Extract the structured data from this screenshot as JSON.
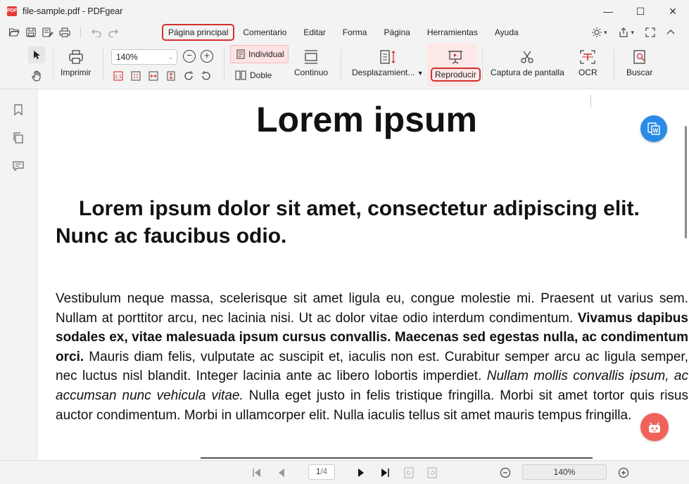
{
  "window": {
    "title": "file-sample.pdf - PDFgear",
    "logo_text": "PDF",
    "minimize": "—",
    "maximize": "☐",
    "close": "✕"
  },
  "menu": {
    "items": [
      {
        "label": "Página principal",
        "active": true
      },
      {
        "label": "Comentario"
      },
      {
        "label": "Editar"
      },
      {
        "label": "Forma"
      },
      {
        "label": "Página"
      },
      {
        "label": "Herramientas"
      },
      {
        "label": "Ayuda"
      }
    ]
  },
  "ribbon": {
    "print_label": "Imprimir",
    "zoom_value": "140%",
    "zoom_out": "−",
    "zoom_in": "+",
    "individual_label": "Individual",
    "double_label": "Doble",
    "continuous_label": "Continuo",
    "scroll_label": "Desplazamient...",
    "play_label": "Reproducir",
    "screenshot_label": "Captura de pantalla",
    "ocr_label": "OCR",
    "search_label": "Buscar"
  },
  "document": {
    "title": "Lorem ipsum",
    "heading": "Lorem ipsum dolor sit amet, consectetur adipiscing elit. Nunc ac faucibus odio.",
    "p1": "Vestibulum neque massa, scelerisque sit amet ligula eu, congue molestie mi. Praesent ut varius sem. Nullam at porttitor arcu, nec lacinia nisi. Ut ac dolor vitae odio interdum condimentum. ",
    "p_bold": "Vivamus dapibus sodales ex, vitae malesuada ipsum cursus convallis. Maecenas sed egestas nulla, ac condimentum orci.",
    "p2": " Mauris diam felis, vulputate ac suscipit et, iaculis non est. Curabitur semper arcu ac ligula semper, nec luctus nisl blandit. Integer lacinia ante ac libero lobortis imperdiet. ",
    "p_italic": "Nullam mollis convallis ipsum, ac accumsan nunc vehicula vitae.",
    "p3": " Nulla eget justo in felis tristique fringilla. Morbi sit amet tortor quis risus auctor condimentum. Morbi in ullamcorper elit. Nulla iaculis tellus sit amet mauris tempus fringilla."
  },
  "statusbar": {
    "current_page": "1",
    "total_pages": "/4",
    "zoom": "140%"
  },
  "colors": {
    "accent": "#d32f2f",
    "highlight": "#fde3e3",
    "fab_blue": "#2a8be6",
    "fab_red": "#f0625a"
  }
}
